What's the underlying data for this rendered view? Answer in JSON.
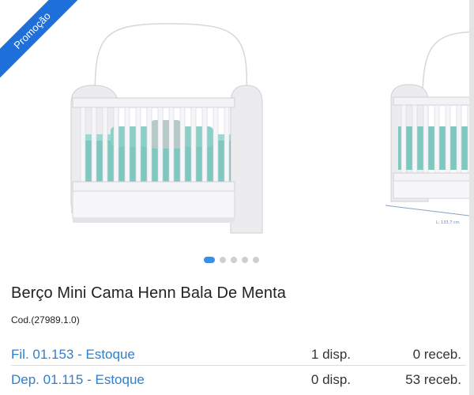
{
  "badge": {
    "label": "Promoção"
  },
  "product": {
    "title": "Berço Mini Cama Henn Bala De Menta",
    "code": "Cod.(27989.1.0)"
  },
  "carousel": {
    "slide_count": 5,
    "active_index": 0,
    "dimension_label": "L: 133,7 cm"
  },
  "stock": [
    {
      "name": "Fil. 01.153 - Estoque",
      "available": "1 disp.",
      "receiving": "0 receb."
    },
    {
      "name": "Dep. 01.115 - Estoque",
      "available": "0 disp.",
      "receiving": "53 receb."
    }
  ],
  "colors": {
    "accent": "#2d7fd0",
    "badge": "#1e6fd9",
    "mattress": "#7fc8c0"
  }
}
